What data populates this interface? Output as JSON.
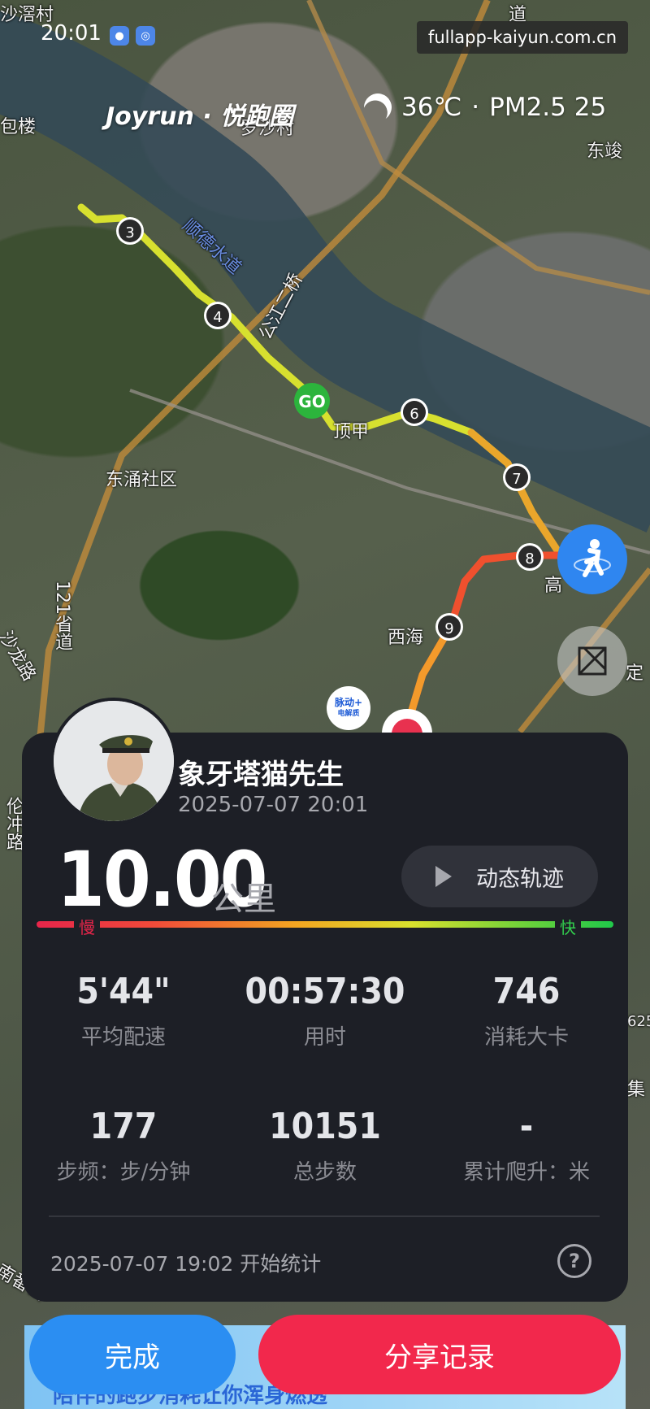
{
  "status": {
    "time": "20:01"
  },
  "watermark": "fullapp-kaiyun.com.cn",
  "brand": "Joyrun · 悦跑圈",
  "weather": {
    "temp": "36℃",
    "separator": "·",
    "air": "PM2.5 25",
    "icon": "moon-icon"
  },
  "map_labels": {
    "top_left": "沙滘村",
    "left_edge": "包楼",
    "village": "罗沙村",
    "east": "东竣",
    "river": "顺德水道",
    "bridge": "公江二桥",
    "town_a": "顶甲",
    "community": "东涌社区",
    "road": "121省道",
    "road2": "沙龙路",
    "west_sea": "西海",
    "gao": "高",
    "ding": "定",
    "right_num": "625",
    "right_char": "集",
    "top_right_char": "道",
    "left_road": "南番公",
    "left_road2": "伦冲路"
  },
  "route_markers": [
    "3",
    "4",
    "GO",
    "6",
    "7",
    "8",
    "9"
  ],
  "ad_badge": {
    "line1": "脉动+",
    "line2": "电解质"
  },
  "profile": {
    "name": "象牙塔猫先生",
    "datetime": "2025-07-07 20:01",
    "avatar": "soldier-avatar"
  },
  "run": {
    "distance": "10.00",
    "unit": "公里",
    "replay_label": "动态轨迹",
    "speed_slow": "慢",
    "speed_fast": "快",
    "stats": [
      {
        "value": "5'44\"",
        "label": "平均配速"
      },
      {
        "value": "00:57:30",
        "label": "用时"
      },
      {
        "value": "746",
        "label": "消耗大卡"
      },
      {
        "value": "177",
        "label": "步频：步/分钟"
      },
      {
        "value": "10151",
        "label": "总步数"
      },
      {
        "value": "-",
        "label": "累计爬升：米"
      }
    ],
    "start_time": "2025-07-07 19:02",
    "start_label": "开始统计"
  },
  "bottom": {
    "banner_text": "陪伴的跑步消耗让你浑身燃透",
    "done": "完成",
    "share": "分享记录"
  }
}
